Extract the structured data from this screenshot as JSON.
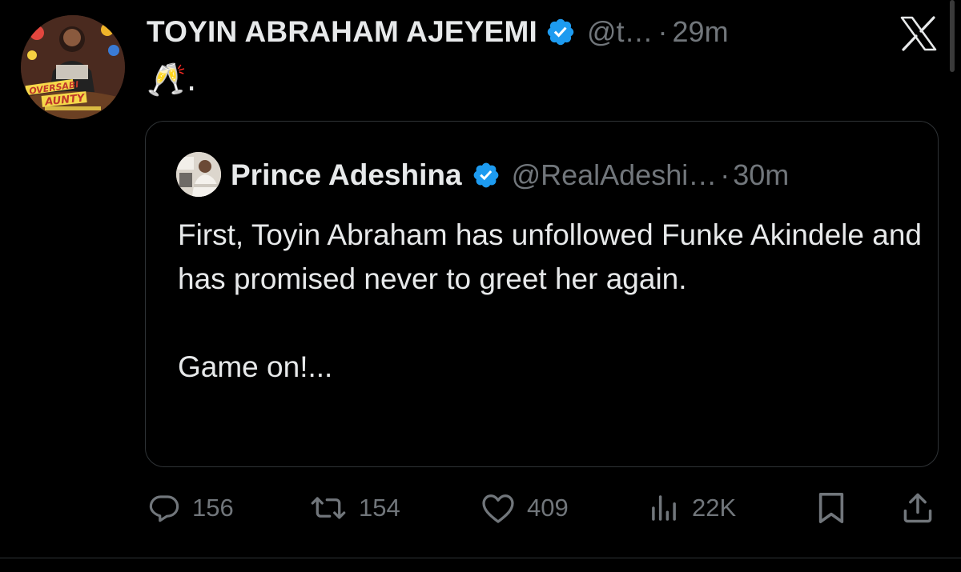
{
  "tweet": {
    "author": {
      "name": "TOYIN ABRAHAM AJEYEMI",
      "handle": "@t…",
      "time": "29m",
      "avatar_text": {
        "line1": "OVERSABI",
        "line2": "AUNTY"
      }
    },
    "separator": "·",
    "text": "🥂."
  },
  "quote": {
    "author": {
      "name": "Prince Adeshina",
      "handle": "@RealAdeshi…",
      "time": "30m"
    },
    "separator": "·",
    "text": "First, Toyin Abraham has unfollowed Funke Akindele and has promised never to greet her again.\n\nGame on!..."
  },
  "actions": {
    "replies": "156",
    "reposts": "154",
    "likes": "409",
    "views": "22K"
  },
  "colors": {
    "background": "#000000",
    "text": "#e7e9ea",
    "muted": "#71767b",
    "border": "#2f3336",
    "verified": "#1d9bf0"
  },
  "icons": {
    "app": "x-logo-icon",
    "verified": "verified-badge-icon",
    "reply": "reply-icon",
    "repost": "repost-icon",
    "like": "heart-icon",
    "views": "views-icon",
    "bookmark": "bookmark-icon",
    "share": "share-icon"
  }
}
